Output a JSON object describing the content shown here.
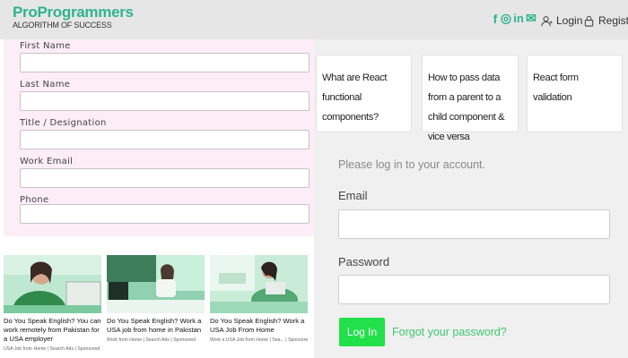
{
  "header": {
    "brand_name": "ProProgrammers",
    "tagline": "ALGORITHM OF SUCCESS",
    "socials": [
      {
        "icon": "facebook-icon",
        "glyph": "f"
      },
      {
        "icon": "instagram-icon",
        "glyph": "◎"
      },
      {
        "icon": "linkedin-icon",
        "glyph": "in"
      },
      {
        "icon": "email-icon",
        "glyph": "✉"
      }
    ],
    "login_label": "Login",
    "register_label": "Register"
  },
  "form": {
    "fields": [
      {
        "label": "First Name",
        "value": ""
      },
      {
        "label": "Last Name",
        "value": ""
      },
      {
        "label": "Title / Designation",
        "value": ""
      },
      {
        "label": "Work Email",
        "value": ""
      },
      {
        "label": "Phone",
        "value": ""
      }
    ]
  },
  "ads": [
    {
      "title": "Do You Speak English? You can work remotely from Pakistan for a USA employer",
      "source": "USA Job from Home | Search Ads | Sponsored"
    },
    {
      "title": "Do You Speak English? Work a USA job from home in Pakistan",
      "source": "Work from Home | Search Ads | Sponsored"
    },
    {
      "title": "Do You Speak English? Work a USA Job From Home",
      "source": "Work a USA Job from Home | Sea... | Sponsored"
    }
  ],
  "articles": [
    {
      "title": "What are React functional components?"
    },
    {
      "title": "How to pass data from a parent to a child component & vice versa"
    },
    {
      "title": "React form validation"
    }
  ],
  "login": {
    "prompt": "Please log in to your account.",
    "email_label": "Email",
    "email_value": "",
    "password_label": "Password",
    "password_value": "",
    "button_label": "Log In",
    "forgot_label": "Forgot your password?"
  },
  "colors": {
    "brand": "#2fb48e",
    "login_button": "#22e04a",
    "form_background": "#fcedf6"
  }
}
